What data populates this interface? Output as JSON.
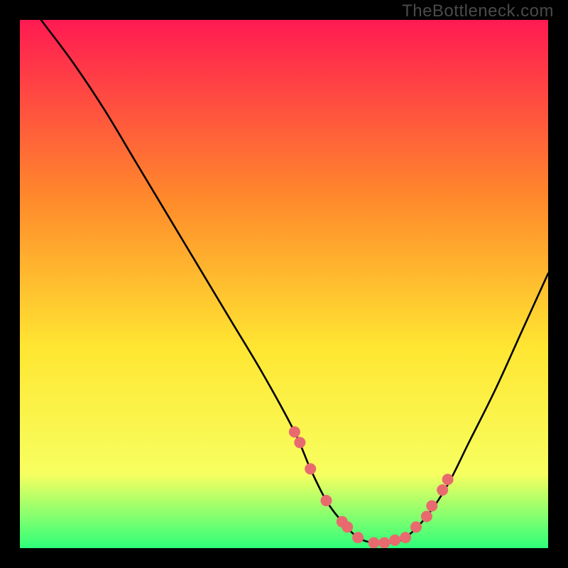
{
  "watermark": "TheBottleneck.com",
  "chart_data": {
    "type": "line",
    "title": "",
    "xlabel": "",
    "ylabel": "",
    "xlim": [
      0,
      100
    ],
    "ylim": [
      0,
      100
    ],
    "grid": false,
    "legend_visible": false,
    "background_gradient": {
      "top": "#ff1a52",
      "mid1": "#ff8a2b",
      "mid2": "#ffe632",
      "lower": "#f7ff60",
      "bottom": "#2eff7a"
    },
    "series": [
      {
        "name": "bottleneck-curve",
        "color": "#000000",
        "x": [
          4,
          10,
          16,
          22,
          28,
          34,
          40,
          46,
          52,
          55,
          58,
          61,
          64,
          67,
          70,
          73,
          77,
          81,
          85,
          90,
          95,
          100
        ],
        "y": [
          100,
          92,
          83,
          73,
          63,
          53,
          43,
          33,
          22,
          15,
          9,
          5,
          2,
          1,
          1,
          2,
          6,
          12,
          20,
          30,
          41,
          52
        ]
      }
    ],
    "marker_points": {
      "name": "highlight-dots",
      "color": "#e86a6f",
      "radius": 8,
      "x": [
        52,
        53,
        55,
        58,
        61,
        62,
        64,
        67,
        69,
        71,
        73,
        75,
        77,
        78,
        80,
        81
      ],
      "y": [
        22,
        20,
        15,
        9,
        5,
        4,
        2,
        1,
        1,
        1.5,
        2,
        4,
        6,
        8,
        11,
        13
      ]
    }
  }
}
